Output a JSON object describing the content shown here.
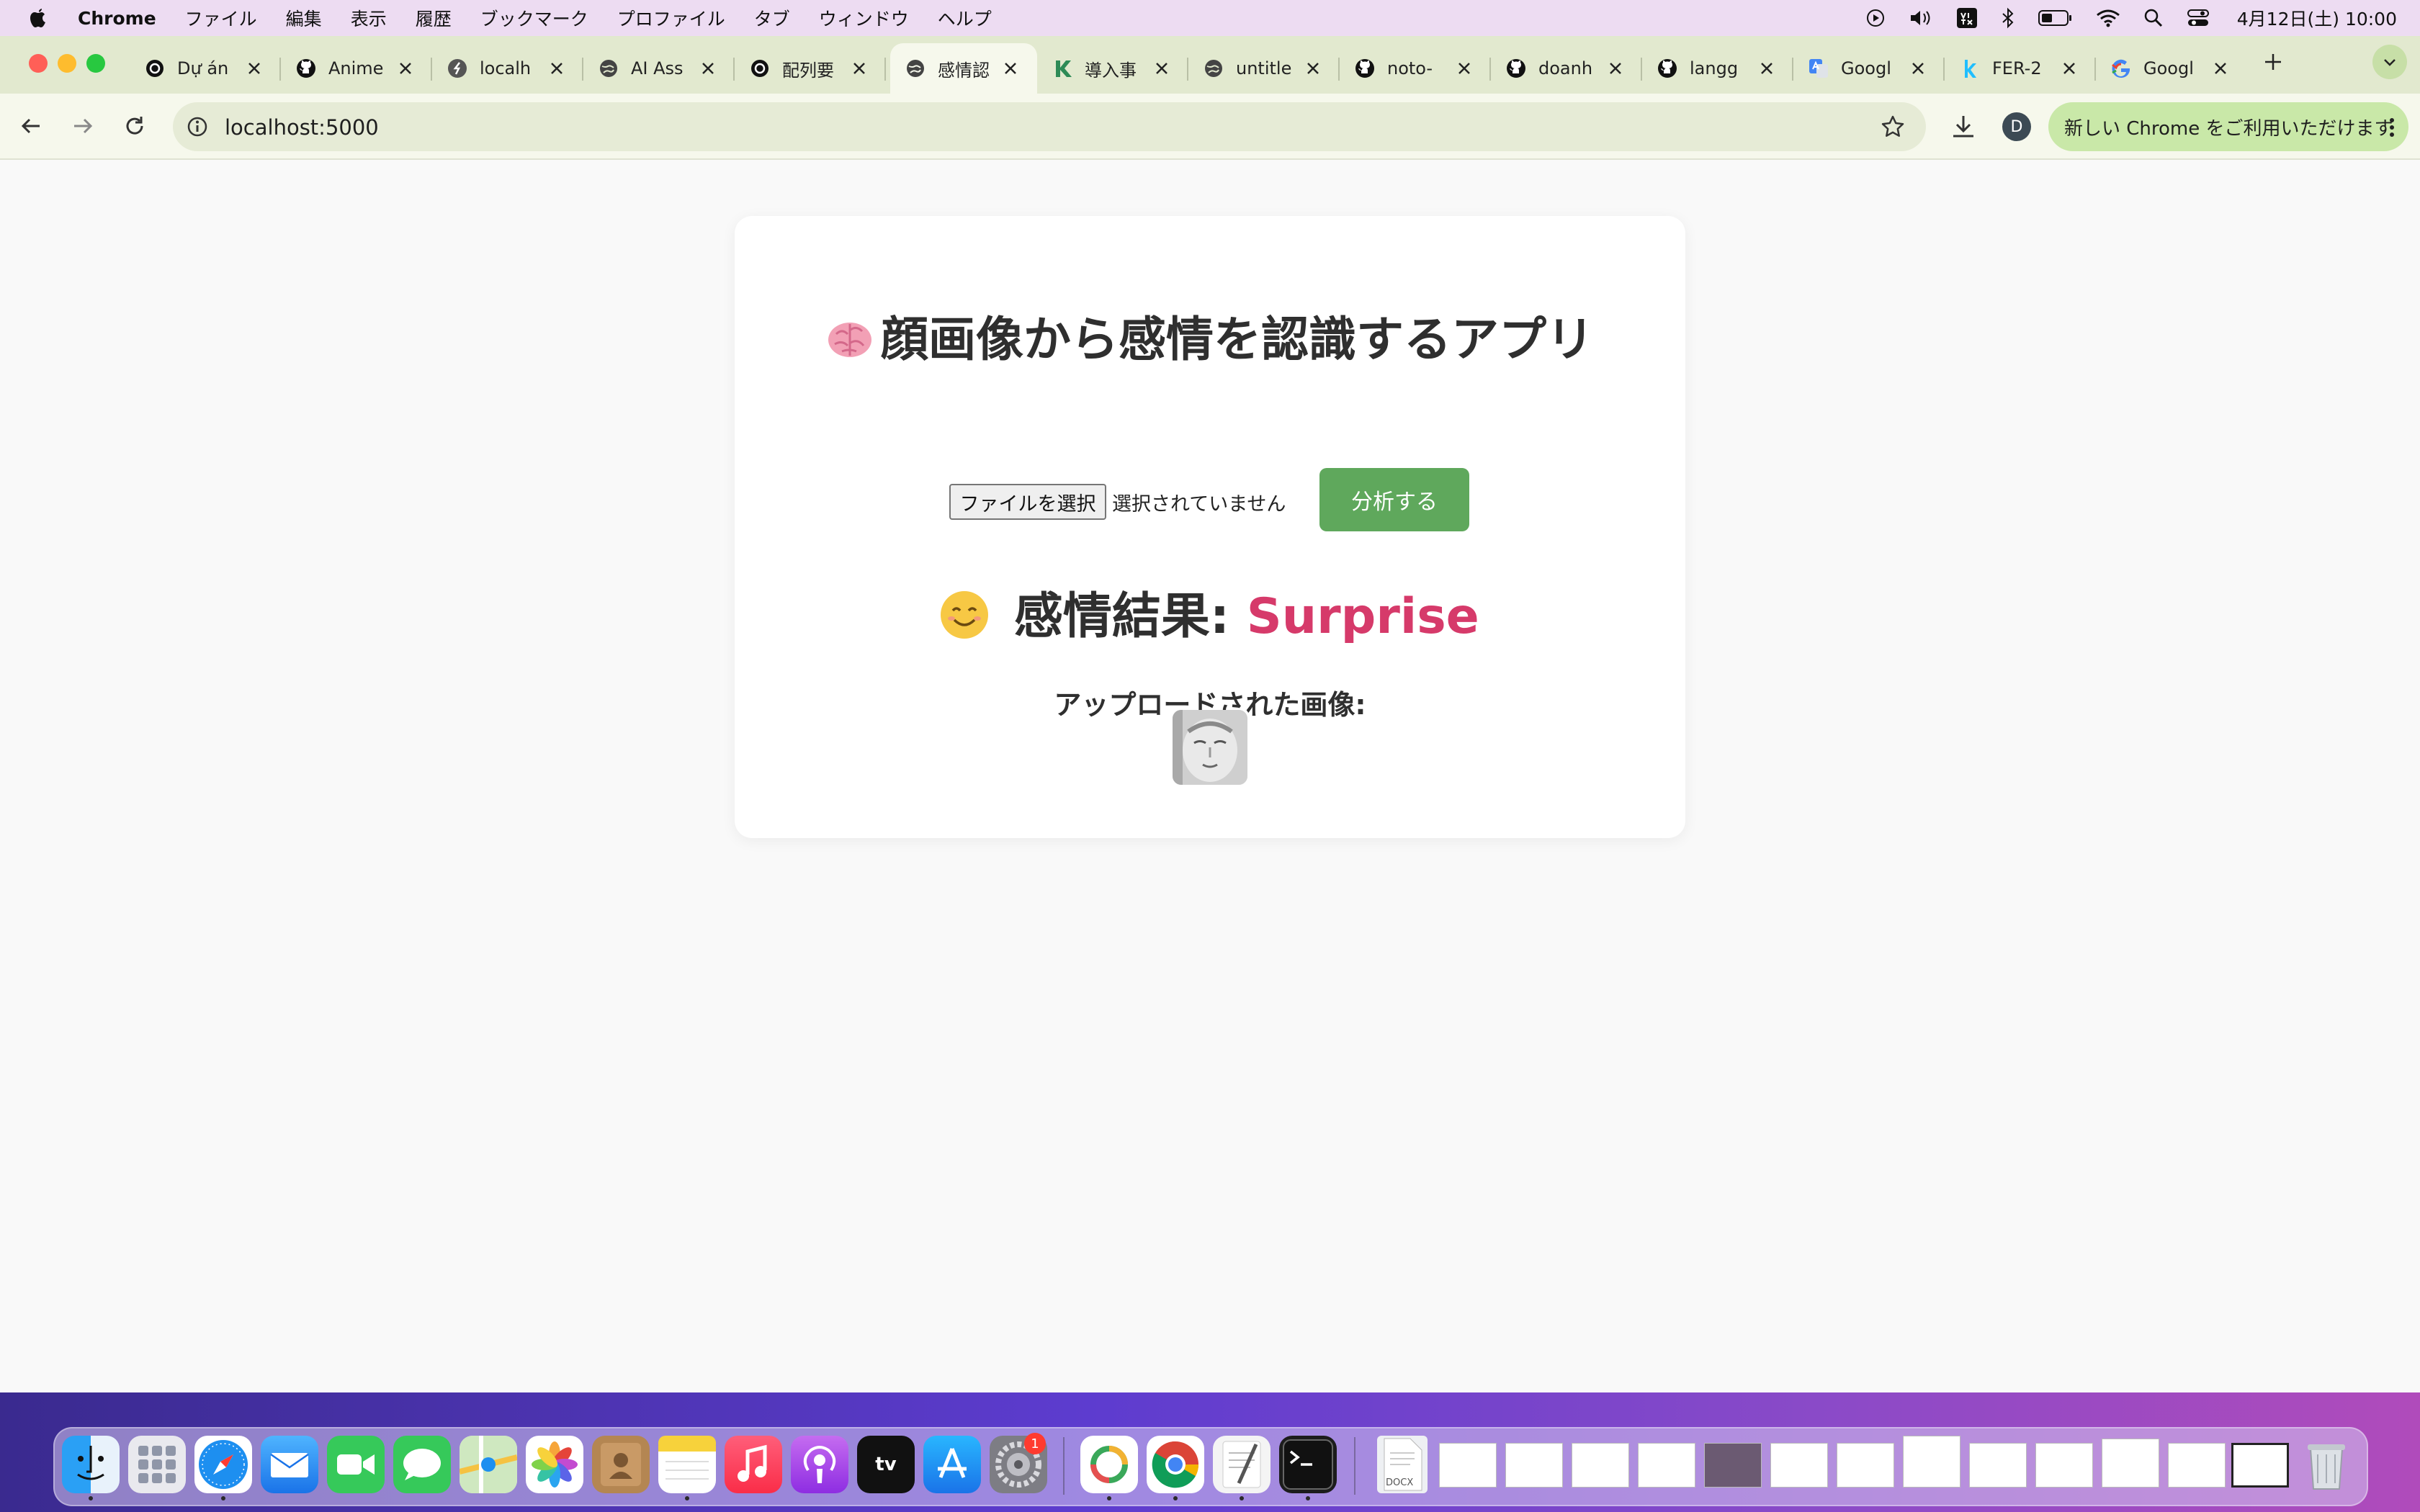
{
  "menubar": {
    "app_name": "Chrome",
    "items": [
      "ファイル",
      "編集",
      "表示",
      "履歴",
      "ブックマーク",
      "プロファイル",
      "タブ",
      "ウィンドウ",
      "ヘルプ"
    ],
    "clock": "4月12日(土) 10:00"
  },
  "browser": {
    "tabs": [
      {
        "title": "Dự án",
        "icon": "openai-icon"
      },
      {
        "title": "Anime",
        "icon": "github-icon"
      },
      {
        "title": "localh",
        "icon": "localhost-icon"
      },
      {
        "title": "AI Ass",
        "icon": "globe-icon"
      },
      {
        "title": "配列要",
        "icon": "openai-icon"
      },
      {
        "title": "感情認",
        "icon": "globe-icon",
        "active": true
      },
      {
        "title": "導入事",
        "icon": "k-icon"
      },
      {
        "title": "untitle",
        "icon": "globe-icon"
      },
      {
        "title": "noto-",
        "icon": "github-icon"
      },
      {
        "title": "doanh",
        "icon": "github-icon"
      },
      {
        "title": "langg",
        "icon": "github-icon"
      },
      {
        "title": "Googl",
        "icon": "google-translate-icon"
      },
      {
        "title": "FER-2",
        "icon": "kaggle-icon"
      },
      {
        "title": "Googl",
        "icon": "google-icon"
      }
    ],
    "url": "localhost:5000",
    "profile_initial": "D",
    "update_label": "新しい Chrome をご利用いただけます"
  },
  "page": {
    "title_emoji": "🧠",
    "title": "顔画像から感情を認識するアプリ",
    "file_button_label": "ファイルを選択",
    "file_status": "選択されていません",
    "analyze_button_label": "分析する",
    "result_prefix": "感情結果:",
    "result_emotion": "Surprise",
    "uploaded_label": "アップロードされた画像:"
  },
  "colors": {
    "accent_green": "#5fa85c",
    "emotion_text": "#d63a6a",
    "tab_strip": "#e2e9cf"
  },
  "dock": {
    "apps": [
      "finder",
      "launchpad",
      "safari",
      "mail",
      "facetime",
      "messages",
      "maps",
      "photos",
      "contacts",
      "notes",
      "music",
      "podcasts",
      "tv",
      "app-store",
      "system-settings",
      "copilot",
      "chrome",
      "textedit",
      "terminal"
    ],
    "tv_label": "tv",
    "settings_badge": "1",
    "docx_label": "DOCX"
  }
}
